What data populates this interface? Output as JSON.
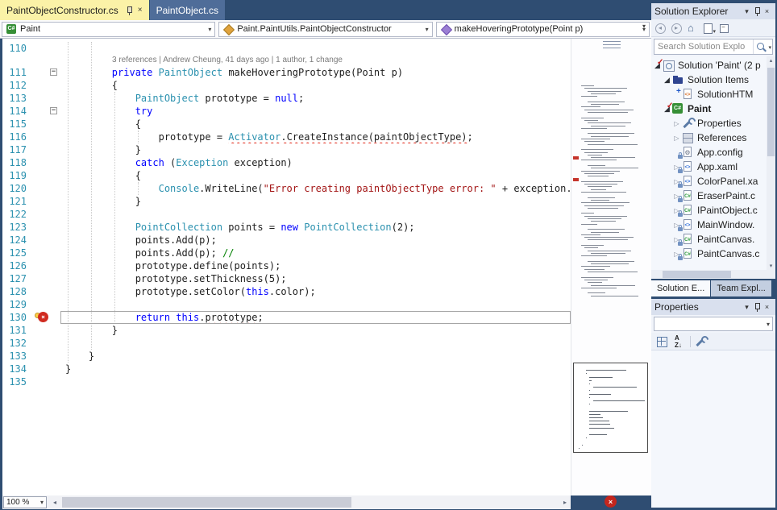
{
  "colors": {
    "chrome_blue": "#2F4D72",
    "active_tab_yellow": "#FBF2A7",
    "keyword_blue": "#0000FF",
    "type_teal": "#2B91AF",
    "string_red": "#A31515",
    "comment_green": "#008000",
    "error_red": "#D02B20",
    "line_number_teal": "#2B91AF"
  },
  "document_tabs": [
    {
      "label": "PaintObjectConstructor.cs",
      "active": true
    },
    {
      "label": "PaintObject.cs",
      "active": false
    }
  ],
  "navigation_bar": {
    "dropdowns": [
      {
        "icon": "csharp-project",
        "label": "Paint"
      },
      {
        "icon": "class",
        "label": "Paint.PaintUtils.PaintObjectConstructor"
      },
      {
        "icon": "method",
        "label": "makeHoveringPrototype(Point p)"
      }
    ]
  },
  "editor": {
    "codelens": "3 references | Andrew Cheung, 41 days ago | 1 author, 1 change",
    "minimap_error_marks": [
      146,
      173,
      420,
      490
    ],
    "lines": [
      {
        "n": 110,
        "t": []
      },
      {
        "n": 111,
        "lens": true,
        "fold": true,
        "t": [
          [
            "p",
            "        "
          ],
          [
            "k",
            "private"
          ],
          [
            "p",
            " "
          ],
          [
            "t",
            "PaintObject"
          ],
          [
            "p",
            " makeHoveringPrototype(Point p)"
          ]
        ]
      },
      {
        "n": 112,
        "t": [
          [
            "p",
            "        {"
          ]
        ]
      },
      {
        "n": 113,
        "t": [
          [
            "p",
            "            "
          ],
          [
            "t",
            "PaintObject"
          ],
          [
            "p",
            " prototype = "
          ],
          [
            "k",
            "null"
          ],
          [
            "p",
            ";"
          ]
        ]
      },
      {
        "n": 114,
        "fold": true,
        "t": [
          [
            "p",
            "            "
          ],
          [
            "k",
            "try"
          ]
        ]
      },
      {
        "n": 115,
        "t": [
          [
            "p",
            "            {"
          ]
        ]
      },
      {
        "n": 116,
        "t": [
          [
            "p",
            "                prototype = "
          ],
          [
            "te",
            "Activator"
          ],
          [
            "pe",
            "."
          ],
          [
            "pe",
            "CreateInstance(paintObjectType)"
          ],
          [
            "p",
            ";"
          ]
        ]
      },
      {
        "n": 117,
        "t": [
          [
            "p",
            "            }"
          ]
        ]
      },
      {
        "n": 118,
        "t": [
          [
            "p",
            "            "
          ],
          [
            "k",
            "catch"
          ],
          [
            "p",
            " ("
          ],
          [
            "t",
            "Exception"
          ],
          [
            "p",
            " exception)"
          ]
        ]
      },
      {
        "n": 119,
        "t": [
          [
            "p",
            "            {"
          ]
        ]
      },
      {
        "n": 120,
        "t": [
          [
            "p",
            "                "
          ],
          [
            "t",
            "Console"
          ],
          [
            "p",
            ".WriteLine("
          ],
          [
            "s",
            "\"Error creating paintObjectType error: \""
          ],
          [
            "p",
            " + exception.Mes"
          ]
        ]
      },
      {
        "n": 121,
        "t": [
          [
            "p",
            "            }"
          ]
        ]
      },
      {
        "n": 122,
        "t": []
      },
      {
        "n": 123,
        "t": [
          [
            "p",
            "            "
          ],
          [
            "t",
            "PointCollection"
          ],
          [
            "p",
            " points = "
          ],
          [
            "k",
            "new"
          ],
          [
            "p",
            " "
          ],
          [
            "t",
            "PointCollection"
          ],
          [
            "p",
            "(2);"
          ]
        ]
      },
      {
        "n": 124,
        "t": [
          [
            "p",
            "            points.Add(p);"
          ]
        ]
      },
      {
        "n": 125,
        "t": [
          [
            "p",
            "            points.Add(p); "
          ],
          [
            "c",
            "//"
          ]
        ]
      },
      {
        "n": 126,
        "t": [
          [
            "p",
            "            prototype.define(points);"
          ]
        ]
      },
      {
        "n": 127,
        "t": [
          [
            "p",
            "            prototype.setThickness(5);"
          ]
        ]
      },
      {
        "n": 128,
        "t": [
          [
            "p",
            "            prototype.setColor("
          ],
          [
            "k",
            "this"
          ],
          [
            "p",
            ".color);"
          ]
        ]
      },
      {
        "n": 129,
        "t": []
      },
      {
        "n": 130,
        "cur": true,
        "err": true,
        "t": [
          [
            "p",
            "            "
          ],
          [
            "k",
            "return"
          ],
          [
            "p",
            " "
          ],
          [
            "k",
            "this"
          ],
          [
            "p",
            "."
          ],
          [
            "pe",
            "prototype"
          ],
          [
            "p",
            ";"
          ]
        ]
      },
      {
        "n": 131,
        "t": [
          [
            "p",
            "        }"
          ]
        ]
      },
      {
        "n": 132,
        "t": []
      },
      {
        "n": 133,
        "t": [
          [
            "p",
            "    }"
          ]
        ]
      },
      {
        "n": 134,
        "t": [
          [
            "p",
            "}"
          ]
        ]
      },
      {
        "n": 135,
        "t": []
      }
    ]
  },
  "status": {
    "zoom": "100 %"
  },
  "solution_explorer": {
    "title": "Solution Explorer",
    "search_placeholder": "Search Solution Explo",
    "header_icons": [
      "window-position",
      "pin",
      "close"
    ],
    "toolbar": [
      "nav-back",
      "nav-forward",
      "home",
      "switch-views",
      "collapse-all"
    ],
    "items": [
      {
        "label": "Solution 'Paint' (2 p",
        "indent": 0,
        "icon": "solution",
        "overlay": "check",
        "expand": "open"
      },
      {
        "label": "Solution Items",
        "indent": 1,
        "icon": "folder",
        "expand": "open"
      },
      {
        "label": "SolutionHTM",
        "indent": 2,
        "icon": "html",
        "overlay": "add"
      },
      {
        "label": "Paint",
        "indent": 1,
        "icon": "csproj",
        "overlay": "check",
        "expand": "open",
        "bold": true
      },
      {
        "label": "Properties",
        "indent": 2,
        "icon": "properties",
        "expand": "closed"
      },
      {
        "label": "References",
        "indent": 2,
        "icon": "references",
        "expand": "closed"
      },
      {
        "label": "App.config",
        "indent": 2,
        "icon": "config",
        "overlay": "lock"
      },
      {
        "label": "App.xaml",
        "indent": 2,
        "icon": "xaml",
        "overlay": "lock",
        "expand": "closed"
      },
      {
        "label": "ColorPanel.xa",
        "indent": 2,
        "icon": "xaml",
        "overlay": "lock",
        "expand": "closed"
      },
      {
        "label": "EraserPaint.c",
        "indent": 2,
        "icon": "cs",
        "overlay": "lock",
        "expand": "closed"
      },
      {
        "label": "IPaintObject.c",
        "indent": 2,
        "icon": "cs",
        "overlay": "lock",
        "expand": "closed"
      },
      {
        "label": "MainWindow.",
        "indent": 2,
        "icon": "xaml",
        "overlay": "lock",
        "expand": "closed"
      },
      {
        "label": "PaintCanvas.",
        "indent": 2,
        "icon": "cs",
        "overlay": "lock",
        "expand": "closed"
      },
      {
        "label": "PaintCanvas.c",
        "indent": 2,
        "icon": "cs",
        "overlay": "lock",
        "expand": "closed"
      }
    ],
    "bottom_tabs": [
      {
        "label": "Solution E...",
        "active": true
      },
      {
        "label": "Team Expl...",
        "active": false
      }
    ]
  },
  "properties_panel": {
    "title": "Properties",
    "header_icons": [
      "window-position",
      "pin",
      "close"
    ],
    "toolbar": [
      "categorized",
      "alphabetical",
      "property-pages"
    ]
  }
}
